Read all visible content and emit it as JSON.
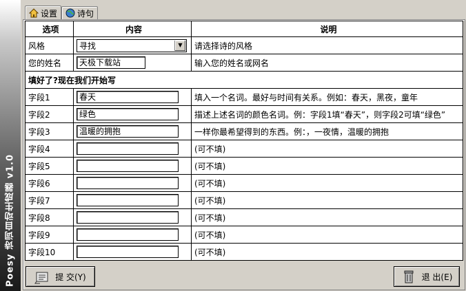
{
  "app": {
    "sidebar_title": "Poesy 诗词自动生成器 v1.0"
  },
  "tabs": [
    {
      "label": "设置"
    },
    {
      "label": "诗句"
    }
  ],
  "table": {
    "headers": {
      "option": "选项",
      "content": "内容",
      "desc": "说明"
    },
    "style_row": {
      "label": "风格",
      "value": "寻找",
      "desc": "请选择诗的风格"
    },
    "name_row": {
      "label": "您的姓名",
      "value": "天极下载站",
      "desc": "输入您的姓名或网名"
    },
    "section_title": "填好了?现在我们开始写",
    "fields": [
      {
        "label": "字段1",
        "value": "春天",
        "desc": "填入一个名词。最好与时间有关系。例如：春天，黑夜，童年"
      },
      {
        "label": "字段2",
        "value": "绿色",
        "desc": "描述上述名词的颜色名词。例：字段1填“春天”，则字段2可填“绿色”"
      },
      {
        "label": "字段3",
        "value": "温暖的拥抱",
        "desc": "一样你最希望得到的东西。例：，一夜情，温暖的拥抱"
      },
      {
        "label": "字段4",
        "value": "",
        "desc": "(可不填)"
      },
      {
        "label": "字段5",
        "value": "",
        "desc": "(可不填)"
      },
      {
        "label": "字段6",
        "value": "",
        "desc": "(可不填)"
      },
      {
        "label": "字段7",
        "value": "",
        "desc": "(可不填)"
      },
      {
        "label": "字段8",
        "value": "",
        "desc": "(可不填)"
      },
      {
        "label": "字段9",
        "value": "",
        "desc": "(可不填)"
      },
      {
        "label": "字段10",
        "value": "",
        "desc": "(可不填)"
      }
    ]
  },
  "buttons": {
    "submit": "提 交(Y)",
    "exit": "退 出(E)"
  }
}
